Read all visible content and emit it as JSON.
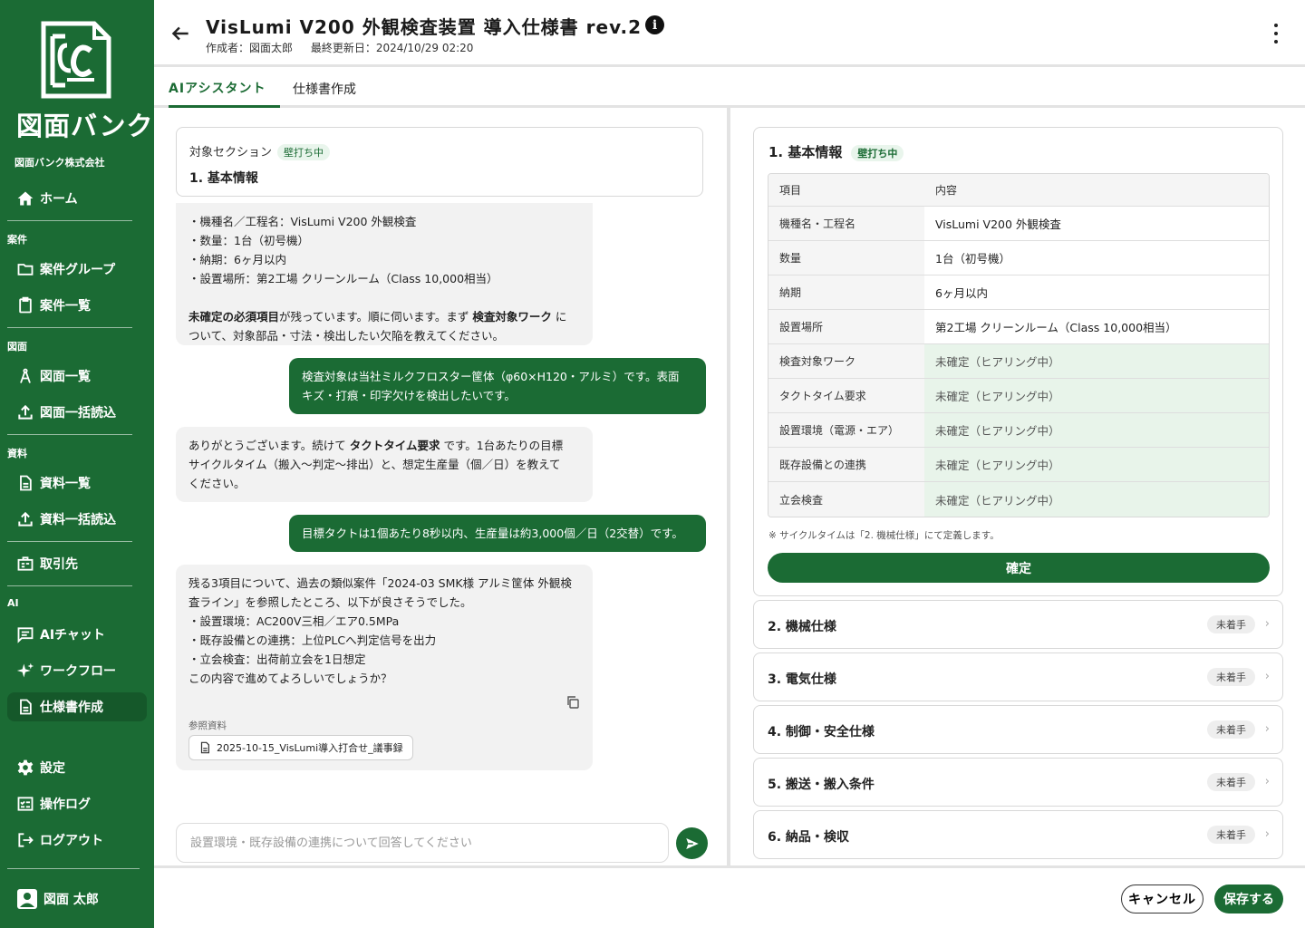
{
  "brand": {
    "logo_text": "図面バンク",
    "company": "図面バンク株式会社",
    "color": "#1b6b34"
  },
  "nav": {
    "home": "ホーム",
    "sections": {
      "projects": "案件",
      "drawings": "図面",
      "materials": "資料",
      "ai": "AI"
    },
    "project_groups": "案件グループ",
    "project_list": "案件一覧",
    "drawing_list": "図面一覧",
    "drawing_bulk": "図面一括読込",
    "material_list": "資料一覧",
    "material_bulk": "資料一括読込",
    "partners": "取引先",
    "ai_chat": "AIチャット",
    "workflow": "ワークフロー",
    "spec_create": "仕様書作成",
    "settings": "設定",
    "oplog": "操作ログ",
    "logout": "ログアウト",
    "user": "図面 太郎"
  },
  "header": {
    "title": "VisLumi V200 外観検査装置 導入仕様書 rev.2",
    "author": "作成者：図面太郎",
    "updated": "最終更新日：2024/10/29 02:20"
  },
  "tabs": {
    "assistant": "AIアシスタント",
    "spec": "仕様書作成"
  },
  "chat": {
    "target_label": "対象セクション",
    "target_badge": "壁打ち中",
    "target_value": "1. 基本情報",
    "m1": {
      "l1": "・機種名／工程名：VisLumi V200 外観検査",
      "l2": "・数量：1台（初号機）",
      "l3": "・納期：6ヶ月以内",
      "l4": "・設置場所：第2工場 クリーンルーム（Class 10,000相当）",
      "l5_b1": "未確定の必須項目",
      "l5_t1": "が残っています。順に伺います。まず ",
      "l5_b2": "検査対象ワーク",
      "l5_t2": " に",
      "l6": "ついて、対象部品・寸法・検出したい欠陥を教えてください。"
    },
    "m2": {
      "l1": "検査対象は当社ミルクフロスター筐体（φ60×H120・アルミ）です。表面",
      "l2": "キズ・打痕・印字欠けを検出したいです。"
    },
    "m3": {
      "l1_t1": "ありがとうございます。続けて ",
      "l1_b1": "タクトタイム要求",
      "l1_t2": " です。1台あたりの目標",
      "l2": "サイクルタイム（搬入〜判定〜排出）と、想定生産量（個／日）を教えて",
      "l3": "ください。"
    },
    "m4": {
      "l1": "目標タクトは1個あたり8秒以内、生産量は約3,000個／日（2交替）です。"
    },
    "m5": {
      "l1": "残る3項目について、過去の類似案件「2024-03 SMK様 アルミ筐体 外観検",
      "l2": "査ライン」を参照したところ、以下が良さそうでした。",
      "l3": "・設置環境：AC200V三相／エア0.5MPa",
      "l4": "・既存設備との連携：上位PLCへ判定信号を出力",
      "l5": "・立会検査：出荷前立会を1日想定",
      "l6": "この内容で進めてよろしいでしょうか？",
      "ref_label": "参照資料",
      "ref_file": "2025-10-15_VisLumi導入打合せ_議事録"
    },
    "input_placeholder": "設置環境・既存設備の連携について回答してください"
  },
  "spec": {
    "title": "1. 基本情報",
    "badge": "壁打ち中",
    "col_item": "項目",
    "col_content": "内容",
    "rows": [
      {
        "k": "機種名・工程名",
        "v": "VisLumi V200 外観検査"
      },
      {
        "k": "数量",
        "v": "1台（初号機）"
      },
      {
        "k": "納期",
        "v": "6ヶ月以内"
      },
      {
        "k": "設置場所",
        "v": "第2工場 クリーンルーム（Class 10,000相当）"
      },
      {
        "k": "検査対象ワーク",
        "v": "未確定（ヒアリング中）"
      },
      {
        "k": "タクトタイム要求",
        "v": "未確定（ヒアリング中）"
      },
      {
        "k": "設置環境（電源・エア）",
        "v": "未確定（ヒアリング中）"
      },
      {
        "k": "既存設備との連携",
        "v": "未確定（ヒアリング中）"
      },
      {
        "k": "立会検査",
        "v": "未確定（ヒアリング中）"
      }
    ],
    "note": "※ サイクルタイムは「2. 機械仕様」にて定義します。",
    "confirm": "確定",
    "sections": [
      {
        "name": "2. 機械仕様",
        "status": "未着手"
      },
      {
        "name": "3. 電気仕様",
        "status": "未着手"
      },
      {
        "name": "4. 制御・安全仕様",
        "status": "未着手"
      },
      {
        "name": "5. 搬送・搬入条件",
        "status": "未着手"
      },
      {
        "name": "6. 納品・検収",
        "status": "未着手"
      }
    ]
  },
  "footer": {
    "cancel": "キャンセル",
    "save": "保存する"
  }
}
